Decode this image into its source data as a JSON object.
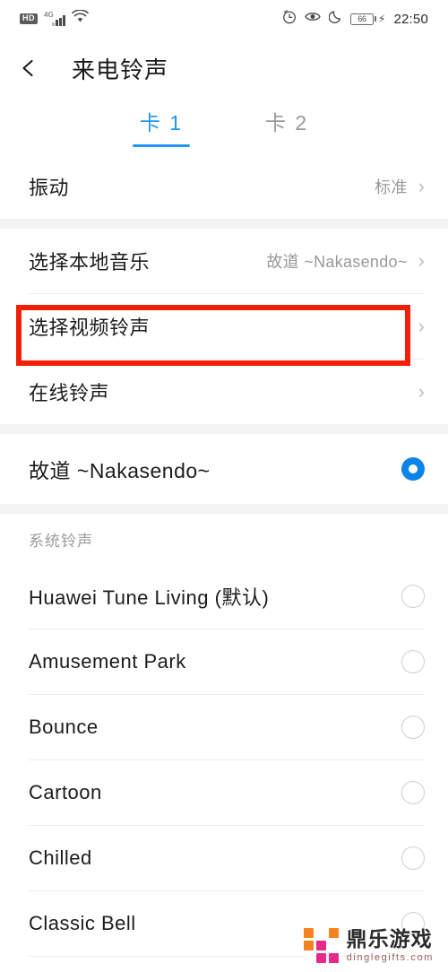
{
  "statusbar": {
    "hd_label": "HD",
    "network_label": "4G",
    "battery_level": "66",
    "time": "22:50",
    "icons": [
      "hd-badge",
      "signal-icon",
      "wifi-icon",
      "alarm-icon",
      "eye-icon",
      "moon-icon",
      "battery-icon",
      "charging-bolt-icon"
    ]
  },
  "header": {
    "back_label": "←",
    "title": "来电铃声"
  },
  "tabs": [
    {
      "label": "卡 1",
      "active": true
    },
    {
      "label": "卡 2",
      "active": false
    }
  ],
  "settings_group": [
    {
      "label": "振动",
      "value": "标准",
      "chevron": "›"
    }
  ],
  "source_group": [
    {
      "label": "选择本地音乐",
      "value": "故道 ~Nakasendo~",
      "chevron": "›"
    },
    {
      "label": "选择视频铃声",
      "value": "",
      "chevron": "›",
      "highlighted": true
    },
    {
      "label": "在线铃声",
      "value": "",
      "chevron": "›"
    }
  ],
  "current_ringtone": {
    "label": "故道 ~Nakasendo~",
    "selected": true
  },
  "system_section": {
    "title": "系统铃声",
    "items": [
      {
        "label": "Huawei Tune Living (默认)",
        "selected": false
      },
      {
        "label": "Amusement Park",
        "selected": false
      },
      {
        "label": "Bounce",
        "selected": false
      },
      {
        "label": "Cartoon",
        "selected": false
      },
      {
        "label": "Chilled",
        "selected": false
      },
      {
        "label": "Classic Bell",
        "selected": false
      }
    ]
  },
  "annotation": {
    "target": "选择视频铃声",
    "color": "#f01f06"
  },
  "watermark": {
    "name": "鼎乐游戏",
    "url": "dinglegifts.com",
    "tiles": [
      "#f5821f",
      "#ffffff",
      "#f5821f",
      "#f5821f",
      "#e8298a",
      "#ffffff",
      "#ffffff",
      "#e8298a",
      "#e8298a"
    ]
  },
  "colors": {
    "accent": "#2196f3",
    "radio_selected": "#0a84e8",
    "annotation": "#f01f06",
    "divider": "#ececec",
    "group_gap": "#f3f3f3"
  }
}
